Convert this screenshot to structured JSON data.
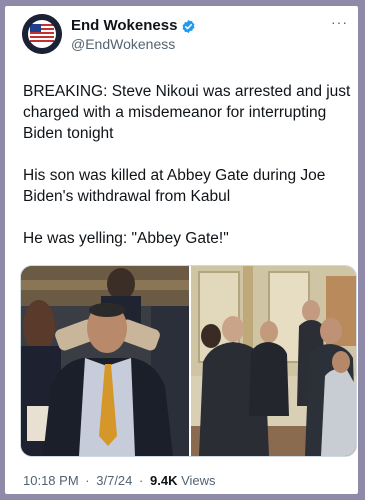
{
  "author": {
    "display_name": "End Wokeness",
    "handle": "@EndWokeness",
    "avatar_icon": "american-flag-seal-avatar"
  },
  "tweet": {
    "paragraphs": [
      "BREAKING: Steve Nikoui was arrested and just charged with a misdemeanor for interrupting Biden tonight",
      "His son was killed at Abbey Gate during Joe Biden's withdrawal from Kabul",
      "He was yelling: \"Abbey Gate!\""
    ]
  },
  "media": {
    "photo_1": "man-shouting-in-audience-photo",
    "photo_2": "group-in-hallway-photo"
  },
  "meta": {
    "time": "10:18 PM",
    "separator": "·",
    "date": "3/7/24",
    "views_count": "9.4K",
    "views_label": "Views"
  },
  "colors": {
    "verified_blue": "#1d9bf0",
    "text_primary": "#0f1419",
    "text_secondary": "#536471",
    "backdrop": "#8e8aa8"
  },
  "more_icon": "ellipsis-icon"
}
